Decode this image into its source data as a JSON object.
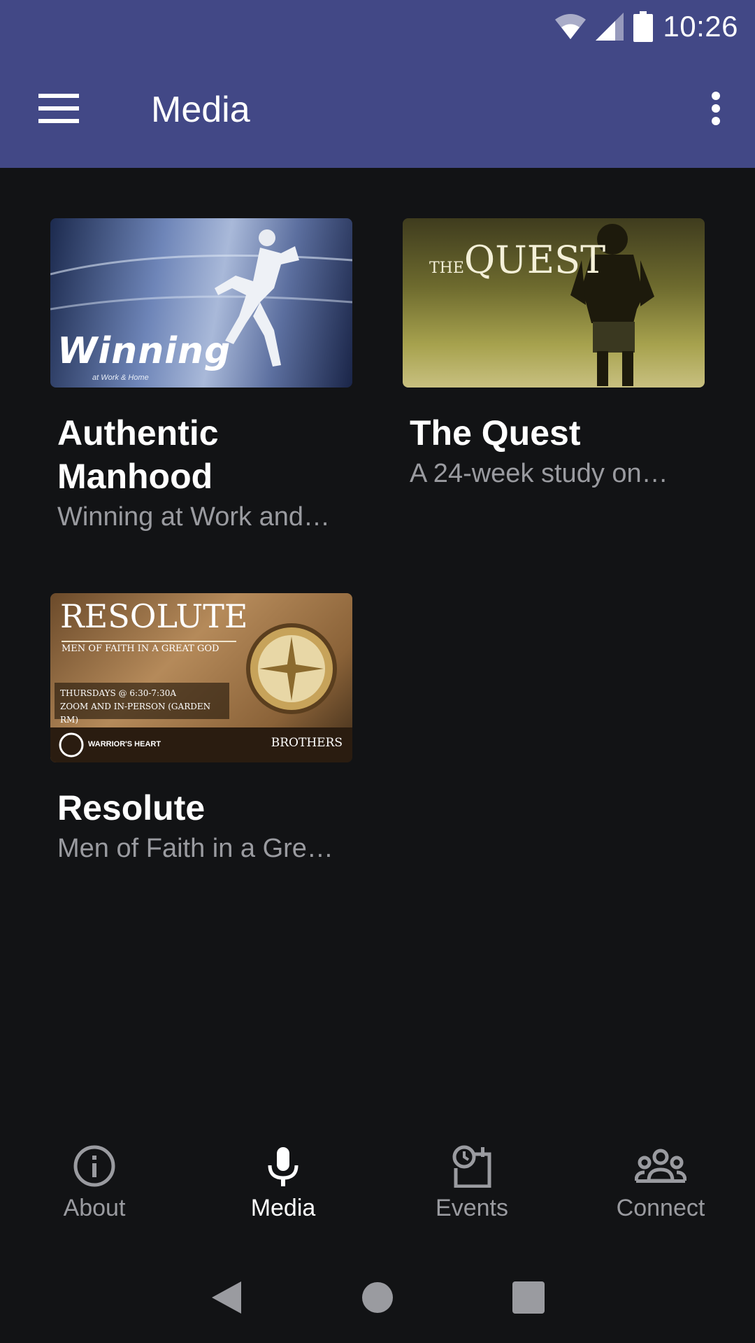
{
  "status": {
    "time": "10:26"
  },
  "appbar": {
    "title": "Media"
  },
  "cards": [
    {
      "title": "Authentic Manhood",
      "subtitle": "Winning at Work and…",
      "image_text": "Winning",
      "image_subtext": "at Work & Home"
    },
    {
      "title": "The Quest",
      "subtitle": "A 24-week study on…",
      "image_text_small": "THE",
      "image_text": "QUEST"
    },
    {
      "title": "Resolute",
      "subtitle": "Men of Faith in a Gre…",
      "image_text": "RESOLUTE",
      "image_subtext": "MEN OF FAITH IN A GREAT GOD",
      "image_line1": "THURSDAYS @ 6:30-7:30A",
      "image_line2": "ZOOM AND IN-PERSON (GARDEN RM)",
      "image_footer_left": "WARRIOR'S HEART",
      "image_footer_right": "BROTHERS"
    }
  ],
  "bottom_nav": [
    {
      "label": "About",
      "icon": "info-icon",
      "active": false
    },
    {
      "label": "Media",
      "icon": "microphone-icon",
      "active": true
    },
    {
      "label": "Events",
      "icon": "calendar-clock-icon",
      "active": false
    },
    {
      "label": "Connect",
      "icon": "people-icon",
      "active": false
    }
  ],
  "colors": {
    "appbar": "#424886",
    "background": "#121315",
    "muted_text": "#9a9ba0"
  }
}
